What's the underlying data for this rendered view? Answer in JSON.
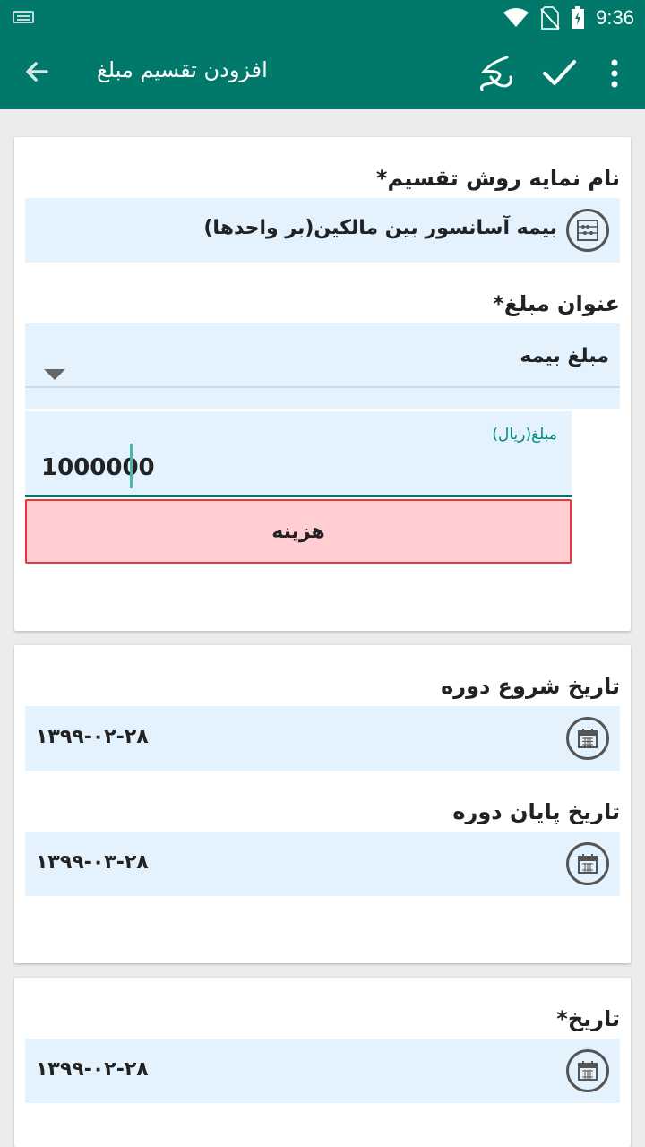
{
  "status_bar": {
    "time": "9:36",
    "icons": [
      "keyboard-icon",
      "wifi-icon",
      "no-sim-icon",
      "battery-icon"
    ]
  },
  "app_bar": {
    "title": "افزودن تقسیم مبلغ",
    "help_label": "کمک",
    "icons": [
      "back-arrow-icon",
      "check-icon",
      "more-vert-icon"
    ]
  },
  "form": {
    "method": {
      "label": "نام نمایه روش تقسیم*",
      "value": "بیمه آسانسور بین مالکین(بر واحدها)"
    },
    "amount_title": {
      "label": "عنوان مبلغ*",
      "value": "مبلغ بیمه"
    },
    "amount": {
      "label": "مبلغ(ریال)",
      "value": "1000000"
    },
    "type_button": {
      "label": "هزینه",
      "color": "#ffcdd2"
    },
    "period_start": {
      "label": "تاریخ شروع دوره",
      "value": "۱۳۹۹-۰۲-۲۸"
    },
    "period_end": {
      "label": "تاریخ پایان دوره",
      "value": "۱۳۹۹-۰۳-۲۸"
    },
    "date": {
      "label": "تاریخ*",
      "value": "۱۳۹۹-۰۲-۲۸"
    }
  },
  "colors": {
    "primary": "#00796b",
    "field_bg": "#e3f2fd",
    "accent": "#00897b",
    "danger_border": "#e53935"
  }
}
